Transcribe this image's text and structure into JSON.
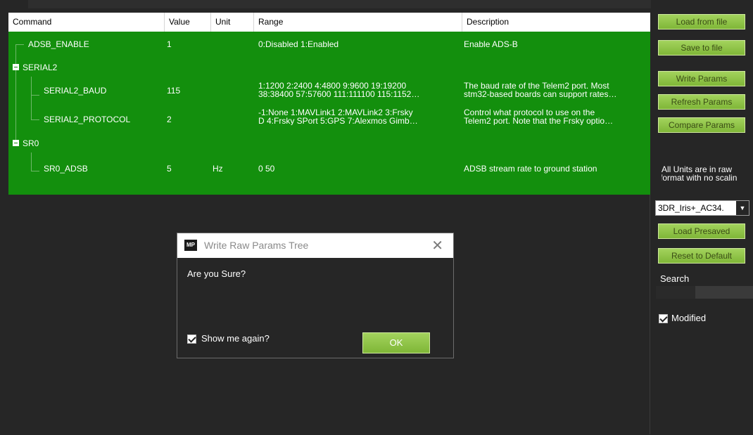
{
  "grid": {
    "columns": [
      "Command",
      "Value",
      "Unit",
      "Range",
      "Description"
    ],
    "rows": [
      {
        "command": "ADSB_ENABLE",
        "value": "1",
        "unit": "",
        "range": "0:Disabled 1:Enabled",
        "description": "Enable ADS-B"
      },
      {
        "group": "SERIAL2"
      },
      {
        "command": "SERIAL2_BAUD",
        "value": "115",
        "unit": "",
        "range1": "1:1200 2:2400 4:4800 9:9600 19:19200",
        "range2": "38:38400  57:57600  111:111100 115:1152…",
        "desc1": "The baud rate of the Telem2 port. Most",
        "desc2": "stm32-based boards can support rates…"
      },
      {
        "command": "SERIAL2_PROTOCOL",
        "value": "2",
        "unit": "",
        "range1": "-1:None  1:MAVLink1  2:MAVLink2  3:Frsky",
        "range2": "D  4:Frsky SPort  5:GPS  7:Alexmos Gimb…",
        "desc1": "Control what protocol to use on the",
        "desc2": "Telem2 port. Note that the Frsky optio…"
      },
      {
        "group": "SR0"
      },
      {
        "command": "SR0_ADSB",
        "value": "5",
        "unit": "Hz",
        "range": "0 50",
        "description": "ADSB stream rate to ground station"
      }
    ]
  },
  "panel": {
    "buttons": [
      "Load from file",
      "Save to file",
      "Write Params",
      "Refresh Params",
      "Compare Params"
    ],
    "note_line1": "All Units are in raw",
    "note_line2": "format with no scalin",
    "preset_selected": "3DR_Iris+_AC34.",
    "load_presaved": "Load Presaved",
    "reset_default": "Reset to Default",
    "search_label": "Search",
    "modified_label": "Modified"
  },
  "dialog": {
    "logo": "MP",
    "title": "Write Raw Params Tree",
    "message": "Are you Sure?",
    "show_again": "Show me again?",
    "ok": "OK"
  },
  "colors": {
    "row_green": "#138f0d",
    "button_green": "#8cc44a",
    "background": "#262626"
  }
}
